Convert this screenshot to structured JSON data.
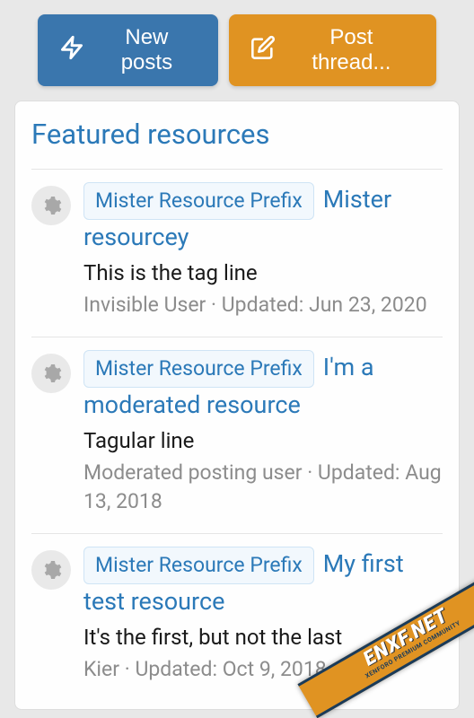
{
  "buttons": {
    "new_posts": "New posts",
    "post_thread": "Post thread..."
  },
  "card": {
    "title": "Featured resources"
  },
  "resources": [
    {
      "prefix": "Mister Resource Prefix",
      "title": "Mister resourcey",
      "tagline": "This is the tag line",
      "author": "Invisible User",
      "updated": "Jun 23, 2020"
    },
    {
      "prefix": "Mister Resource Prefix",
      "title": "I'm a moderated resource",
      "tagline": "Tagular line",
      "author": "Moderated posting user",
      "updated": "Aug 13, 2018"
    },
    {
      "prefix": "Mister Resource Prefix",
      "title": "My first test resource",
      "tagline": "It's the first, but not the last",
      "author": "Kier",
      "updated": "Oct 9, 2018"
    }
  ],
  "meta_label": "Updated:",
  "watermark": {
    "main": "ENXF.NET",
    "sub": "XENFORO PREMIUM COMMUNITY"
  }
}
